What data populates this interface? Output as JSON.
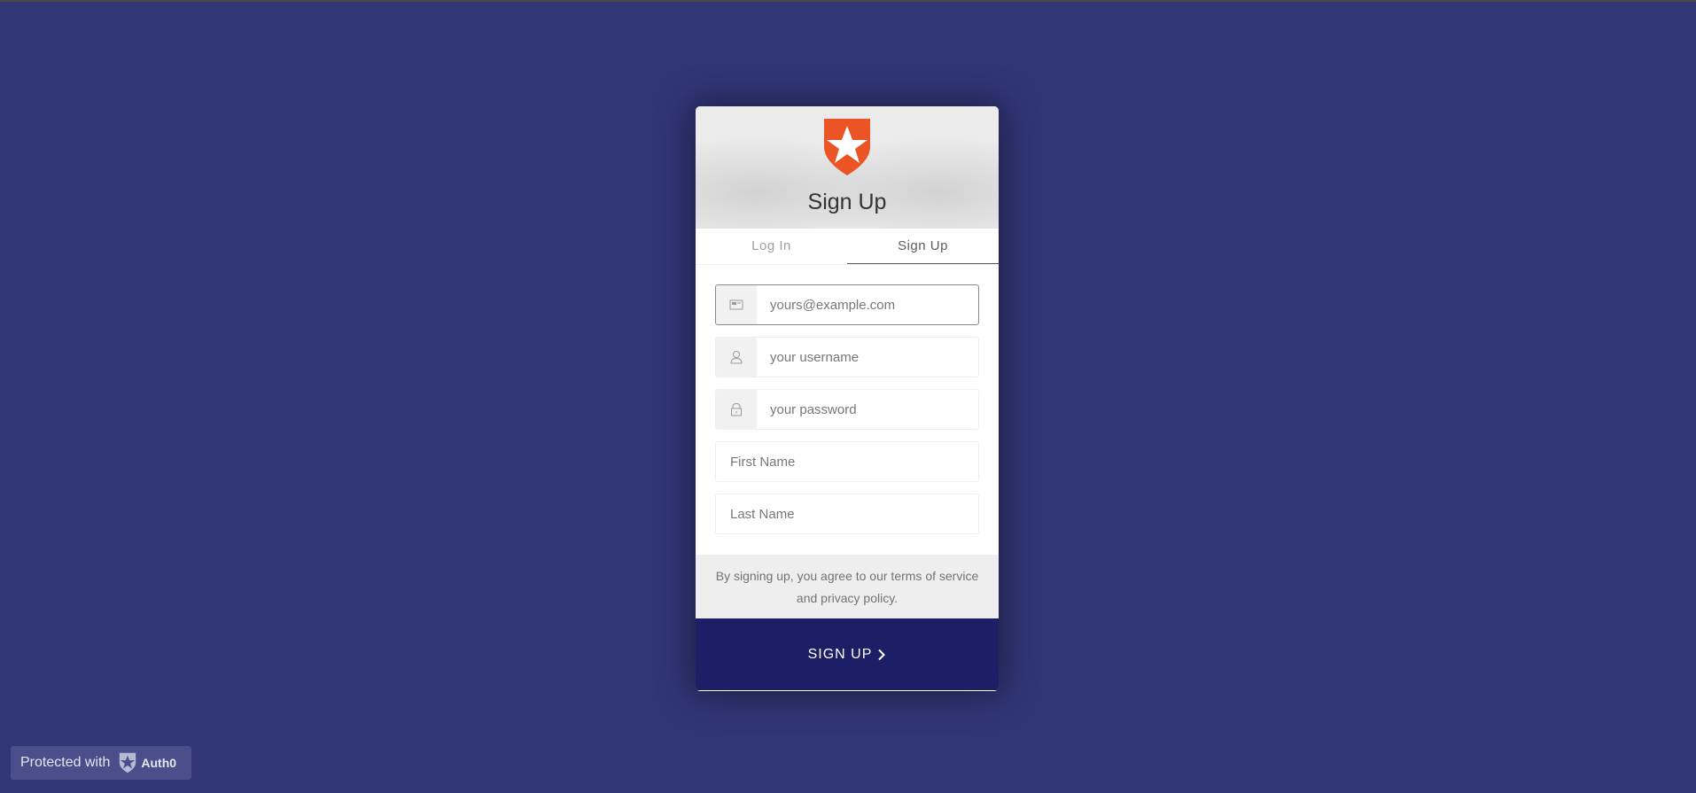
{
  "page": {
    "background_color": "#313677"
  },
  "card": {
    "title": "Sign Up",
    "logo_icon": "auth0-shield-star-icon",
    "logo_color": "#eb5424",
    "tabs": [
      {
        "label": "Log In",
        "active": false
      },
      {
        "label": "Sign Up",
        "active": true
      }
    ],
    "fields": {
      "email": {
        "placeholder": "yours@example.com",
        "value": "",
        "icon": "envelope-icon"
      },
      "username": {
        "placeholder": "your username",
        "value": "",
        "icon": "user-icon"
      },
      "password": {
        "placeholder": "your password",
        "value": "",
        "icon": "lock-icon"
      },
      "first_name": {
        "placeholder": "First Name",
        "value": ""
      },
      "last_name": {
        "placeholder": "Last Name",
        "value": ""
      }
    },
    "terms_text": "By signing up, you agree to our terms of service and privacy policy.",
    "submit_label": "SIGN UP",
    "submit_color": "#1c1f65"
  },
  "badge": {
    "prefix": "Protected with",
    "brand": "Auth0"
  }
}
